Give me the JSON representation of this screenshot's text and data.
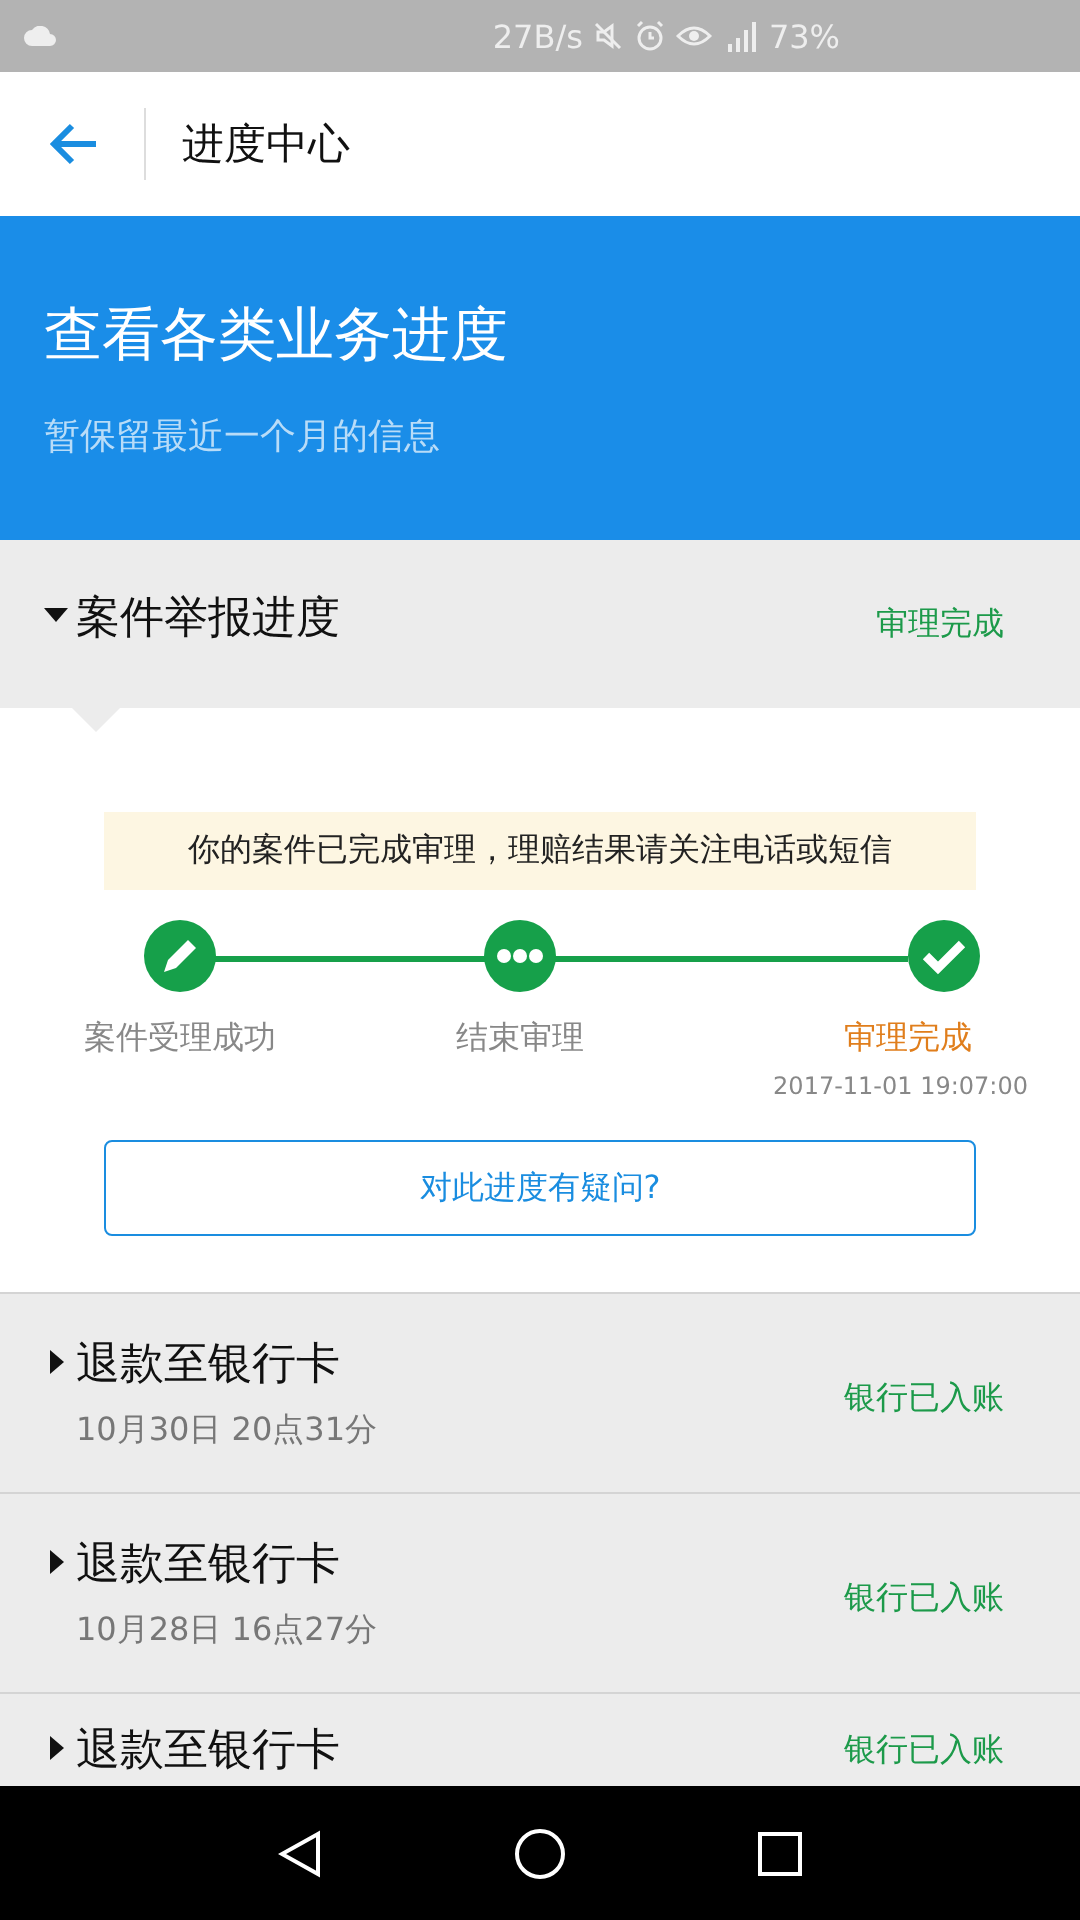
{
  "status_bar": {
    "speed": "27B/s",
    "battery": "73%"
  },
  "header": {
    "title": "进度中心"
  },
  "banner": {
    "title": "查看各类业务进度",
    "subtitle": "暂保留最近一个月的信息"
  },
  "sections": [
    {
      "title": "案件举报进度",
      "status": "审理完成",
      "expanded": true,
      "notice": "你的案件已完成审理，理赔结果请关注电话或短信",
      "steps": [
        {
          "label": "案件受理成功",
          "kind": "pencil",
          "current": false
        },
        {
          "label": "结束审理",
          "kind": "dots",
          "current": false
        },
        {
          "label": "审理完成",
          "kind": "check",
          "current": true,
          "time": "2017-11-01 19:07:00"
        }
      ],
      "question_button": "对此进度有疑问?"
    },
    {
      "title": "退款至银行卡",
      "date": "10月30日  20点31分",
      "status": "银行已入账",
      "expanded": false
    },
    {
      "title": "退款至银行卡",
      "date": "10月28日  16点27分",
      "status": "银行已入账",
      "expanded": false
    },
    {
      "title": "退款至银行卡",
      "status": "银行已入账",
      "expanded": false
    }
  ]
}
